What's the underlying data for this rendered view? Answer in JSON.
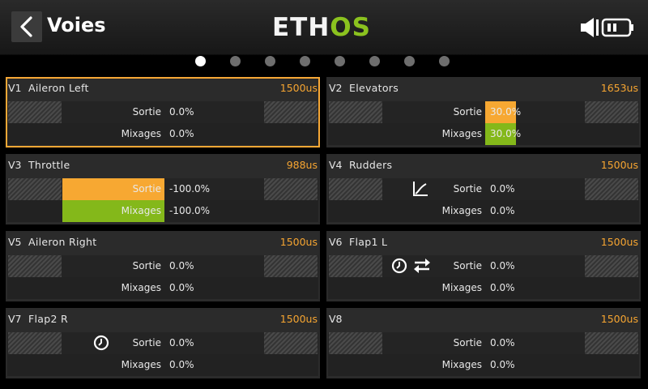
{
  "header": {
    "title": "Voies",
    "logo_part1": "ETH",
    "logo_part2": "OS"
  },
  "pages": {
    "count": 8,
    "active": 1
  },
  "labels": {
    "output": "Sortie",
    "mixes": "Mixages"
  },
  "colors": {
    "accent": "#f7a836",
    "green": "#84b81a",
    "us": "#f6a531"
  },
  "channels": [
    {
      "id": "V1",
      "name": "Aileron Left",
      "us": "1500us",
      "output": "0.0%",
      "mixes": "0.0%",
      "selected": true,
      "output_percent": 0,
      "mixes_percent": 0,
      "icons": []
    },
    {
      "id": "V2",
      "name": "Elevators",
      "us": "1653us",
      "output": "30.0%",
      "mixes": "30.0%",
      "selected": false,
      "output_percent": 30,
      "mixes_percent": 30,
      "icons": []
    },
    {
      "id": "V3",
      "name": "Throttle",
      "us": "988us",
      "output": "-100.0%",
      "mixes": "-100.0%",
      "selected": false,
      "output_percent": -100,
      "mixes_percent": -100,
      "icons": []
    },
    {
      "id": "V4",
      "name": "Rudders",
      "us": "1500us",
      "output": "0.0%",
      "mixes": "0.0%",
      "selected": false,
      "output_percent": 0,
      "mixes_percent": 0,
      "icons": [
        "curve-icon"
      ]
    },
    {
      "id": "V5",
      "name": "Aileron Right",
      "us": "1500us",
      "output": "0.0%",
      "mixes": "0.0%",
      "selected": false,
      "output_percent": 0,
      "mixes_percent": 0,
      "icons": []
    },
    {
      "id": "V6",
      "name": "Flap1 L",
      "us": "1500us",
      "output": "0.0%",
      "mixes": "0.0%",
      "selected": false,
      "output_percent": 0,
      "mixes_percent": 0,
      "icons": [
        "clock-icon",
        "reverse-icon"
      ]
    },
    {
      "id": "V7",
      "name": "Flap2 R",
      "us": "1500us",
      "output": "0.0%",
      "mixes": "0.0%",
      "selected": false,
      "output_percent": 0,
      "mixes_percent": 0,
      "icons": [
        "clock-icon"
      ]
    },
    {
      "id": "V8",
      "name": "",
      "us": "1500us",
      "output": "0.0%",
      "mixes": "0.0%",
      "selected": false,
      "output_percent": 0,
      "mixes_percent": 0,
      "icons": []
    }
  ]
}
